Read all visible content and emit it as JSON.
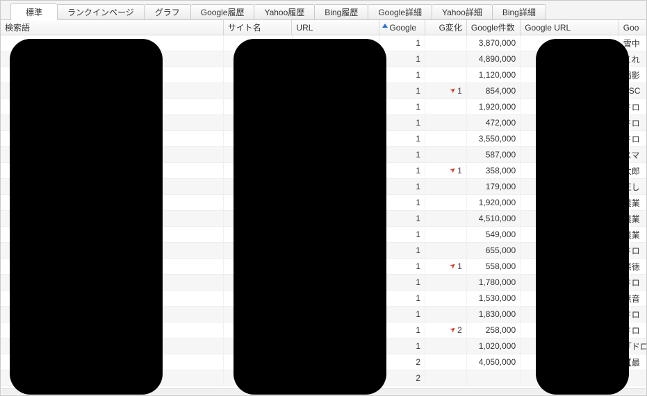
{
  "tabs": [
    {
      "label": "標準",
      "active": true
    },
    {
      "label": "ランクインページ"
    },
    {
      "label": "グラフ"
    },
    {
      "label": "Google履歴"
    },
    {
      "label": "Yahoo履歴"
    },
    {
      "label": "Bing履歴"
    },
    {
      "label": "Google詳細"
    },
    {
      "label": "Yahoo詳細"
    },
    {
      "label": "Bing詳細"
    }
  ],
  "columns": {
    "search": "検索語",
    "site": "サイト名",
    "url": "URL",
    "google": "Google",
    "gchange": "G変化",
    "gcount": "Google件数",
    "gurl": "Google URL",
    "gtitle": "Goo"
  },
  "sort": {
    "column": "google",
    "direction": "asc"
  },
  "rows": [
    {
      "google": "1",
      "gchange": "",
      "gcount": "3,870,000",
      "gtitle": "雪中"
    },
    {
      "google": "1",
      "gchange": "",
      "gcount": "4,890,000",
      "gtitle": "これ"
    },
    {
      "google": "1",
      "gchange": "",
      "gcount": "1,120,000",
      "gtitle": "掲影"
    },
    {
      "google": "1",
      "gchange": "1",
      "gcount": "854,000",
      "gtitle": "ESC"
    },
    {
      "google": "1",
      "gchange": "",
      "gcount": "1,920,000",
      "gtitle": "ドロ"
    },
    {
      "google": "1",
      "gchange": "",
      "gcount": "472,000",
      "gtitle": "ドロ"
    },
    {
      "google": "1",
      "gchange": "",
      "gcount": "3,550,000",
      "gtitle": "ドロ"
    },
    {
      "google": "1",
      "gchange": "",
      "gcount": "587,000",
      "gtitle": "スマ"
    },
    {
      "google": "1",
      "gchange": "1",
      "gcount": "358,000",
      "gtitle": "太郎"
    },
    {
      "google": "1",
      "gchange": "",
      "gcount": "179,000",
      "gtitle": "正し"
    },
    {
      "google": "1",
      "gchange": "",
      "gcount": "1,920,000",
      "gtitle": "農業"
    },
    {
      "google": "1",
      "gchange": "",
      "gcount": "4,510,000",
      "gtitle": "農業"
    },
    {
      "google": "1",
      "gchange": "",
      "gcount": "549,000",
      "gtitle": "農業"
    },
    {
      "google": "1",
      "gchange": "",
      "gcount": "655,000",
      "gtitle": "ドロ"
    },
    {
      "google": "1",
      "gchange": "1",
      "gcount": "558,000",
      "gtitle": "悪徳"
    },
    {
      "google": "1",
      "gchange": "",
      "gcount": "1,780,000",
      "gtitle": "ドロ"
    },
    {
      "google": "1",
      "gchange": "",
      "gcount": "1,530,000",
      "gtitle": "無音"
    },
    {
      "google": "1",
      "gchange": "",
      "gcount": "1,830,000",
      "gtitle": "ドロ"
    },
    {
      "google": "1",
      "gchange": "2",
      "gcount": "258,000",
      "gtitle": "ドロ"
    },
    {
      "google": "1",
      "gchange": "",
      "gcount": "1,020,000",
      "gtitle": "「ドロ"
    },
    {
      "google": "2",
      "gchange": "",
      "gcount": "4,050,000",
      "gtitle": "【最"
    },
    {
      "google": "2",
      "gchange": "",
      "gcount": "",
      "gtitle": ""
    }
  ],
  "partial_bottom_text": ""
}
